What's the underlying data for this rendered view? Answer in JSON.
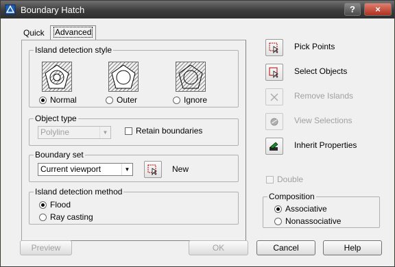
{
  "window": {
    "title": "Boundary Hatch",
    "help_symbol": "?",
    "close_symbol": "×"
  },
  "tabs": [
    {
      "label": "Quick"
    },
    {
      "label": "Advanced"
    }
  ],
  "island_detection_style": {
    "legend": "Island detection style",
    "options": [
      {
        "label": "Normal",
        "selected": true
      },
      {
        "label": "Outer",
        "selected": false
      },
      {
        "label": "Ignore",
        "selected": false
      }
    ]
  },
  "object_type": {
    "legend": "Object type",
    "value": "Polyline",
    "retain_label": "Retain boundaries",
    "retain_checked": false
  },
  "boundary_set": {
    "legend": "Boundary set",
    "value": "Current viewport",
    "new_label": "New"
  },
  "island_detection_method": {
    "legend": "Island detection method",
    "options": [
      {
        "label": "Flood",
        "selected": true
      },
      {
        "label": "Ray casting",
        "selected": false
      }
    ]
  },
  "actions": [
    {
      "label": "Pick Points",
      "icon": "pick-points-icon",
      "enabled": true
    },
    {
      "label": "Select Objects",
      "icon": "select-objects-icon",
      "enabled": true
    },
    {
      "label": "Remove Islands",
      "icon": "remove-islands-icon",
      "enabled": false
    },
    {
      "label": "View Selections",
      "icon": "view-selections-icon",
      "enabled": false
    },
    {
      "label": "Inherit Properties",
      "icon": "inherit-properties-icon",
      "enabled": true
    }
  ],
  "double": {
    "label": "Double",
    "checked": false,
    "enabled": false
  },
  "composition": {
    "legend": "Composition",
    "options": [
      {
        "label": "Associative",
        "selected": true
      },
      {
        "label": "Nonassociative",
        "selected": false
      }
    ]
  },
  "buttons": {
    "preview": "Preview",
    "ok": "OK",
    "cancel": "Cancel",
    "help": "Help"
  }
}
